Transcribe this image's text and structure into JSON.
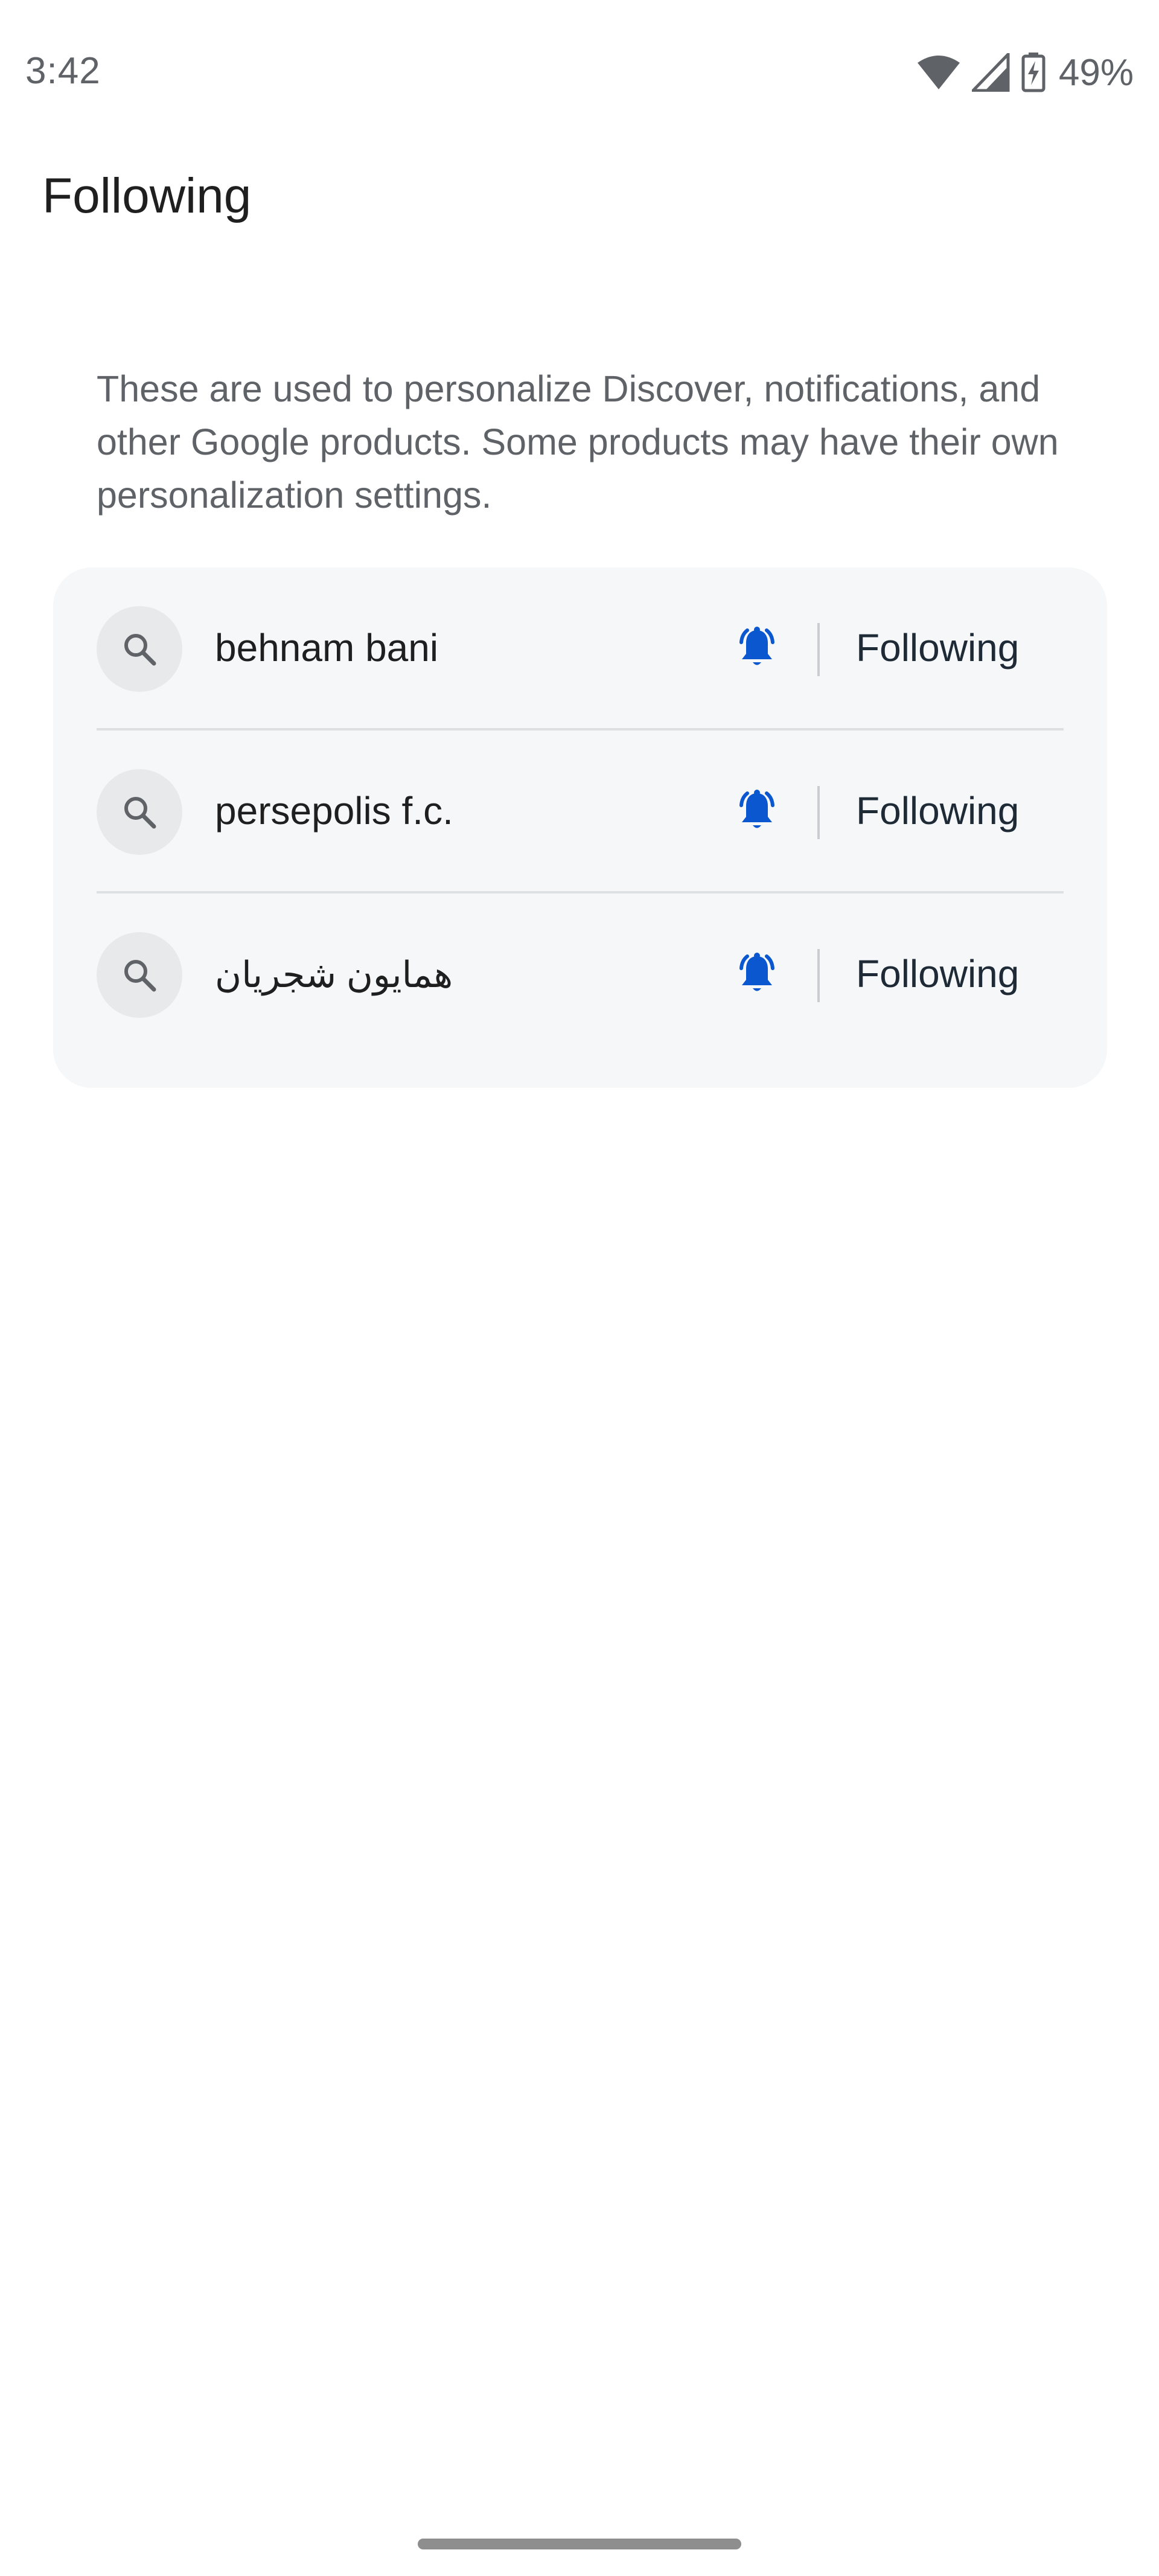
{
  "status_bar": {
    "time": "3:42",
    "battery_percent": "49%",
    "icons": [
      "wifi-icon",
      "cell-signal-icon",
      "battery-charging-icon"
    ]
  },
  "page": {
    "title": "Following",
    "description": "These are used to personalize Discover, notifications, and other Google products. Some products may have their own personalization settings."
  },
  "topics": [
    {
      "name": "behnam bani",
      "button_label": "Following",
      "notifications_on": true
    },
    {
      "name": "persepolis f.c.",
      "button_label": "Following",
      "notifications_on": true
    },
    {
      "name": "همایون شجریان",
      "button_label": "Following",
      "notifications_on": true
    }
  ],
  "colors": {
    "accent_blue": "#0b57d0",
    "card_background": "#f5f7f9",
    "muted_text": "#5f6368"
  }
}
